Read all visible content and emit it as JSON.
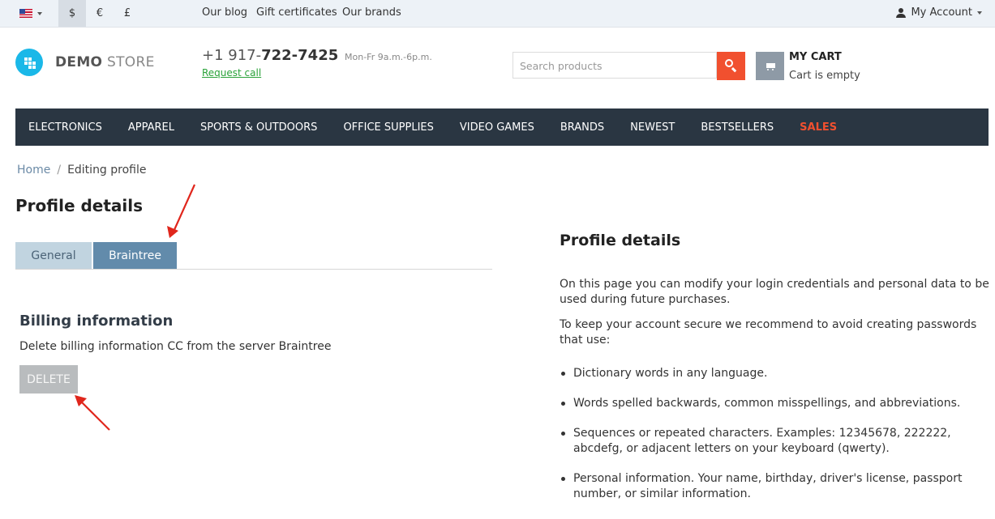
{
  "topbar": {
    "currencies": [
      "$",
      "€",
      "£"
    ],
    "links": [
      "Our blog",
      "Gift certificates",
      "Our brands"
    ],
    "account_label": "My Account"
  },
  "header": {
    "logo_bold": "DEMO",
    "logo_light": "STORE",
    "phone_prefix": "+1 917-",
    "phone_main": "722-7425",
    "hours": "Mon-Fr 9a.m.-6p.m.",
    "request_call": "Request call",
    "search_placeholder": "Search products",
    "cart_title": "MY CART",
    "cart_status": "Cart is empty"
  },
  "nav": {
    "items": [
      "ELECTRONICS",
      "APPAREL",
      "SPORTS & OUTDOORS",
      "OFFICE SUPPLIES",
      "VIDEO GAMES",
      "BRANDS",
      "NEWEST",
      "BESTSELLERS",
      "SALES"
    ]
  },
  "breadcrumb": {
    "home": "Home",
    "separator": "/",
    "current": "Editing profile"
  },
  "main": {
    "title": "Profile details",
    "tabs": [
      "General",
      "Braintree"
    ],
    "active_tab": "Braintree",
    "billing_title": "Billing information",
    "billing_desc": "Delete billing information CC from the server Braintree",
    "delete_label": "DELETE"
  },
  "sidebar": {
    "title": "Profile details",
    "para1": "On this page you can modify your login credentials and personal data to be used during future purchases.",
    "para2": "To keep your account secure we recommend to avoid creating passwords that use:",
    "bullets": [
      "Dictionary words in any language.",
      "Words spelled backwards, common misspellings, and abbreviations.",
      "Sequences or repeated characters. Examples: 12345678, 222222, abcdefg, or adjacent letters on your keyboard (qwerty).",
      "Personal information. Your name, birthday, driver's license, passport number, or similar information."
    ]
  },
  "colors": {
    "accent": "#f1502f",
    "nav_bg": "#2a3642",
    "logo": "#1ab8e8",
    "tab_active": "#628bab",
    "tab_inactive": "#c1d4e0",
    "annotation_arrow": "#e0261c"
  },
  "icons": [
    "us-flag-icon",
    "user-icon",
    "search-icon",
    "cart-icon",
    "logo-icon"
  ]
}
